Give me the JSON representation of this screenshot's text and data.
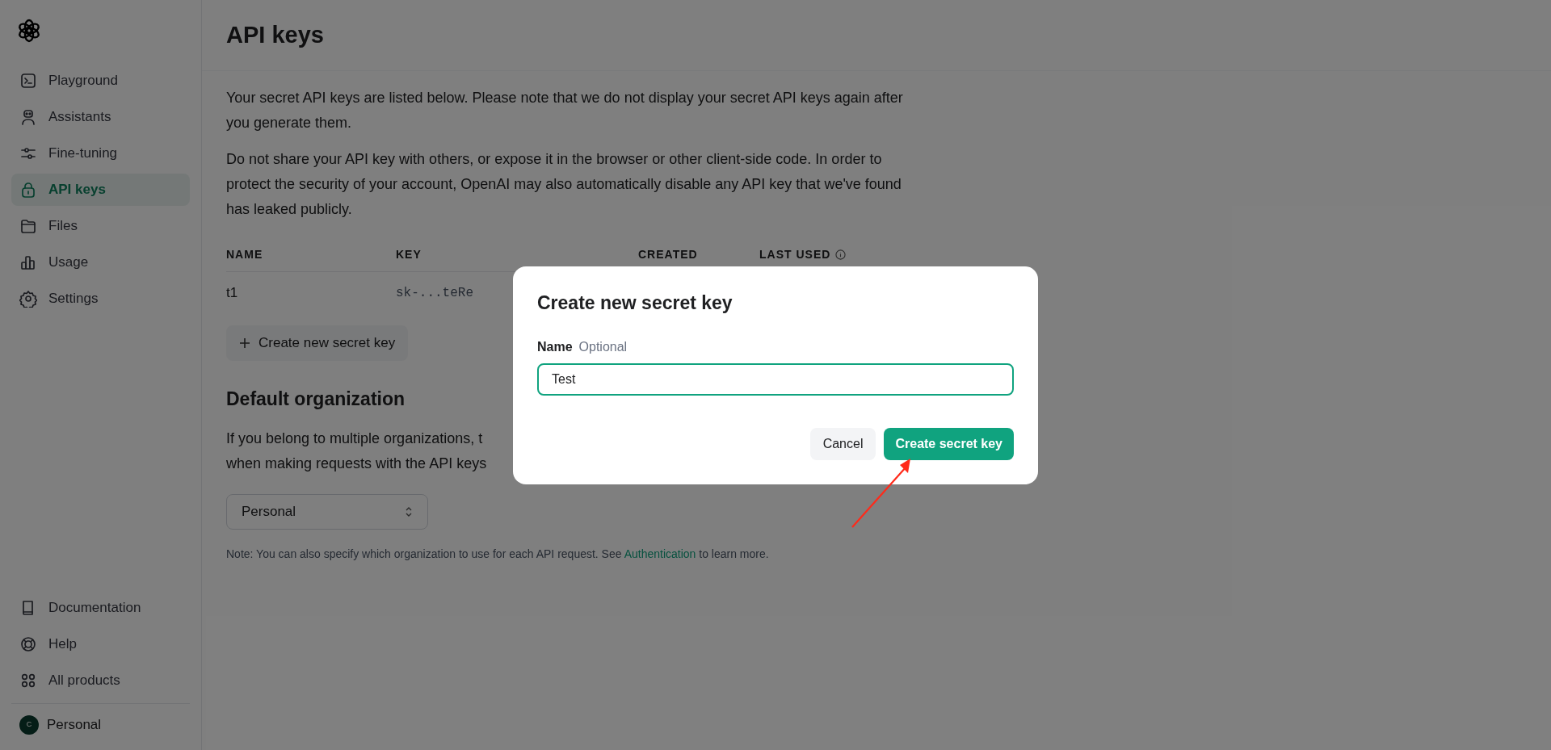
{
  "sidebar": {
    "nav_items": [
      {
        "label": "Playground",
        "selected": false
      },
      {
        "label": "Assistants",
        "selected": false
      },
      {
        "label": "Fine-tuning",
        "selected": false
      },
      {
        "label": "API keys",
        "selected": true
      },
      {
        "label": "Files",
        "selected": false
      },
      {
        "label": "Usage",
        "selected": false
      },
      {
        "label": "Settings",
        "selected": false
      }
    ],
    "footer_items": [
      {
        "label": "Documentation"
      },
      {
        "label": "Help"
      },
      {
        "label": "All products"
      }
    ],
    "account": {
      "initial": "C",
      "label": "Personal"
    }
  },
  "page": {
    "title": "API keys",
    "paragraphs": [
      "Your secret API keys are listed below. Please note that we do not display your secret API keys again after you generate them.",
      "Do not share your API key with others, or expose it in the browser or other client-side code. In order to protect the security of your account, OpenAI may also automatically disable any API key that we've found has leaked publicly."
    ],
    "table": {
      "columns": [
        "NAME",
        "KEY",
        "CREATED",
        "LAST USED"
      ],
      "rows": [
        {
          "name": "t1",
          "key": "sk-...teRe"
        }
      ]
    },
    "create_button": "Create new secret key",
    "org_heading": "Default organization",
    "org_lines": [
      "If you belong to multiple organizations, t",
      "when making requests with the API keys"
    ],
    "org_select": "Personal",
    "note": {
      "before": "Note: You can also specify which organization to use for each API request. See",
      "link": "Authentication",
      "after": "to learn more."
    }
  },
  "dialog": {
    "title": "Create new secret key",
    "field_label": "Name",
    "field_hint": "Optional",
    "field_value": "Test",
    "buttons": [
      {
        "label": "Cancel",
        "kind": "secondary"
      },
      {
        "label": "Create secret key",
        "kind": "primary"
      }
    ]
  }
}
